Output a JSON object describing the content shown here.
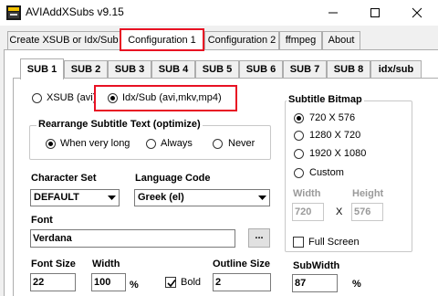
{
  "window": {
    "title": "AVIAddXSubs v9.15"
  },
  "top_tabs": [
    {
      "label": "Create XSUB or Idx/Sub"
    },
    {
      "label": "Configuration 1"
    },
    {
      "label": "Configuration 2"
    },
    {
      "label": "ffmpeg"
    },
    {
      "label": "About"
    }
  ],
  "sub_tabs": [
    {
      "label": "SUB 1"
    },
    {
      "label": "SUB 2"
    },
    {
      "label": "SUB 3"
    },
    {
      "label": "SUB 4"
    },
    {
      "label": "SUB 5"
    },
    {
      "label": "SUB 6"
    },
    {
      "label": "SUB 7"
    },
    {
      "label": "SUB 8"
    },
    {
      "label": "idx/sub"
    }
  ],
  "format": {
    "xsub_label": "XSUB (avi)",
    "idxsub_label": "Idx/Sub (avi,mkv,mp4)",
    "selected": "Idx/Sub (avi,mkv,mp4)"
  },
  "rearrange": {
    "title": "Rearrange Subtitle Text (optimize)",
    "options": [
      "When very long",
      "Always",
      "Never"
    ],
    "selected": "When very long"
  },
  "character_set": {
    "label": "Character Set",
    "value": "DEFAULT"
  },
  "language_code": {
    "label": "Language Code",
    "value": "Greek (el)"
  },
  "font": {
    "label": "Font",
    "value": "Verdana",
    "browse_label": "..."
  },
  "font_size": {
    "label": "Font Size",
    "value": "22"
  },
  "width": {
    "label": "Width",
    "value": "100",
    "unit": "%"
  },
  "bold": {
    "label": "Bold",
    "checked": true
  },
  "outline_size": {
    "label": "Outline Size",
    "value": "2"
  },
  "subtitle_bitmap": {
    "title": "Subtitle Bitmap",
    "options": [
      "720 X 576",
      "1280 X 720",
      "1920 X 1080",
      "Custom"
    ],
    "selected": "720 X 576",
    "width_label": "Width",
    "height_label": "Height",
    "width_value": "720",
    "height_value": "576",
    "x_label": "X",
    "full_screen_label": "Full Screen",
    "full_screen_checked": false
  },
  "sub_width": {
    "label": "SubWidth",
    "value": "87",
    "unit": "%"
  },
  "colors": {
    "highlight_red": "#e81123",
    "tab_border": "#adadad",
    "panel_bg": "#ffffff",
    "window_bg": "#f0f0f0"
  }
}
